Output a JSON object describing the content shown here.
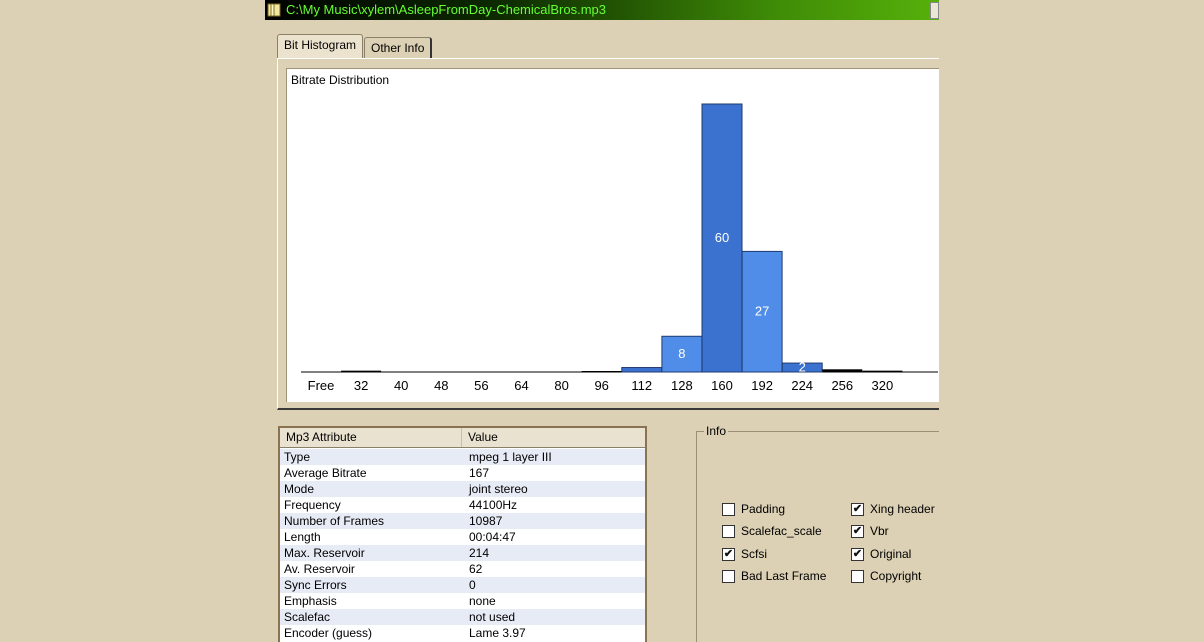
{
  "window": {
    "title": "C:\\My Music\\xylem\\AsleepFromDay-ChemicalBros.mp3"
  },
  "tabs": [
    {
      "label": "Bit Histogram",
      "active": true
    },
    {
      "label": "Other Info",
      "active": false
    }
  ],
  "chart_data": {
    "type": "bar",
    "title": "Bitrate Distribution",
    "categories": [
      "Free",
      "32",
      "40",
      "48",
      "56",
      "64",
      "80",
      "96",
      "112",
      "128",
      "160",
      "192",
      "224",
      "256",
      "320"
    ],
    "values": [
      0,
      0.3,
      0,
      0,
      0,
      0,
      0,
      0.2,
      1,
      8,
      60,
      27,
      2,
      0.6,
      0.3
    ],
    "data_labels": [
      "",
      "",
      "",
      "",
      "",
      "",
      "",
      "",
      "",
      "8",
      "60",
      "27",
      "2",
      "",
      ""
    ],
    "ylim": [
      0,
      60
    ],
    "colors": {
      "bar_dark": "#3b72d0",
      "bar_light": "#4f8de8",
      "bar_border": "#1f3a70"
    }
  },
  "attributes": {
    "headers": [
      "Mp3 Attribute",
      "Value"
    ],
    "rows": [
      {
        "name": "Type",
        "value": "mpeg 1 layer III"
      },
      {
        "name": "Average Bitrate",
        "value": "167"
      },
      {
        "name": "Mode",
        "value": "joint stereo"
      },
      {
        "name": "Frequency",
        "value": "44100Hz"
      },
      {
        "name": "Number of Frames",
        "value": "10987"
      },
      {
        "name": "Length",
        "value": "00:04:47"
      },
      {
        "name": "Max. Reservoir",
        "value": "214"
      },
      {
        "name": "Av. Reservoir",
        "value": "62"
      },
      {
        "name": "Sync Errors",
        "value": "0"
      },
      {
        "name": "Emphasis",
        "value": "none"
      },
      {
        "name": "Scalefac",
        "value": "not used"
      },
      {
        "name": "Encoder (guess)",
        "value": "Lame 3.97"
      }
    ]
  },
  "info": {
    "legend": "Info",
    "checkboxes": [
      {
        "label": "Padding",
        "checked": false
      },
      {
        "label": "Scalefac_scale",
        "checked": false
      },
      {
        "label": "Scfsi",
        "checked": true
      },
      {
        "label": "Bad Last Frame",
        "checked": false
      },
      {
        "label": "Xing header",
        "checked": true
      },
      {
        "label": "Vbr",
        "checked": true
      },
      {
        "label": "Original",
        "checked": true
      },
      {
        "label": "Copyright",
        "checked": false
      }
    ]
  },
  "colors": {
    "title_text": "#66ff33",
    "window_bg": "#ddd1b5"
  }
}
